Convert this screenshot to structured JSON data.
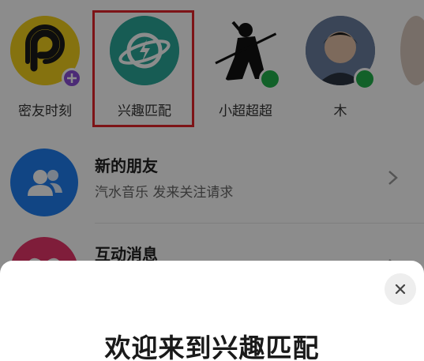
{
  "stories": [
    {
      "name": "密友时刻",
      "icon": "p-logo-icon"
    },
    {
      "name": "兴趣匹配",
      "icon": "planet-bolt-icon"
    },
    {
      "name": "小超超超",
      "icon": "ninja-silhouette-icon"
    },
    {
      "name": "木",
      "icon": "user-photo-avatar"
    }
  ],
  "list": [
    {
      "title": "新的朋友",
      "subtitle": "汽水音乐 发来关注请求",
      "icon": "people-icon"
    },
    {
      "title": "互动消息",
      "subtitle": "",
      "icon": "heart-icon"
    }
  ],
  "sheet": {
    "title": "欢迎来到兴趣匹配",
    "close_icon": "close-icon"
  },
  "colors": {
    "highlight": "#e3262a",
    "interest_match": "#2aa899",
    "new_friends": "#1f7ef0",
    "interaction": "#e8356a",
    "online": "#22b14c",
    "plus_badge": "#8a4fd8"
  }
}
